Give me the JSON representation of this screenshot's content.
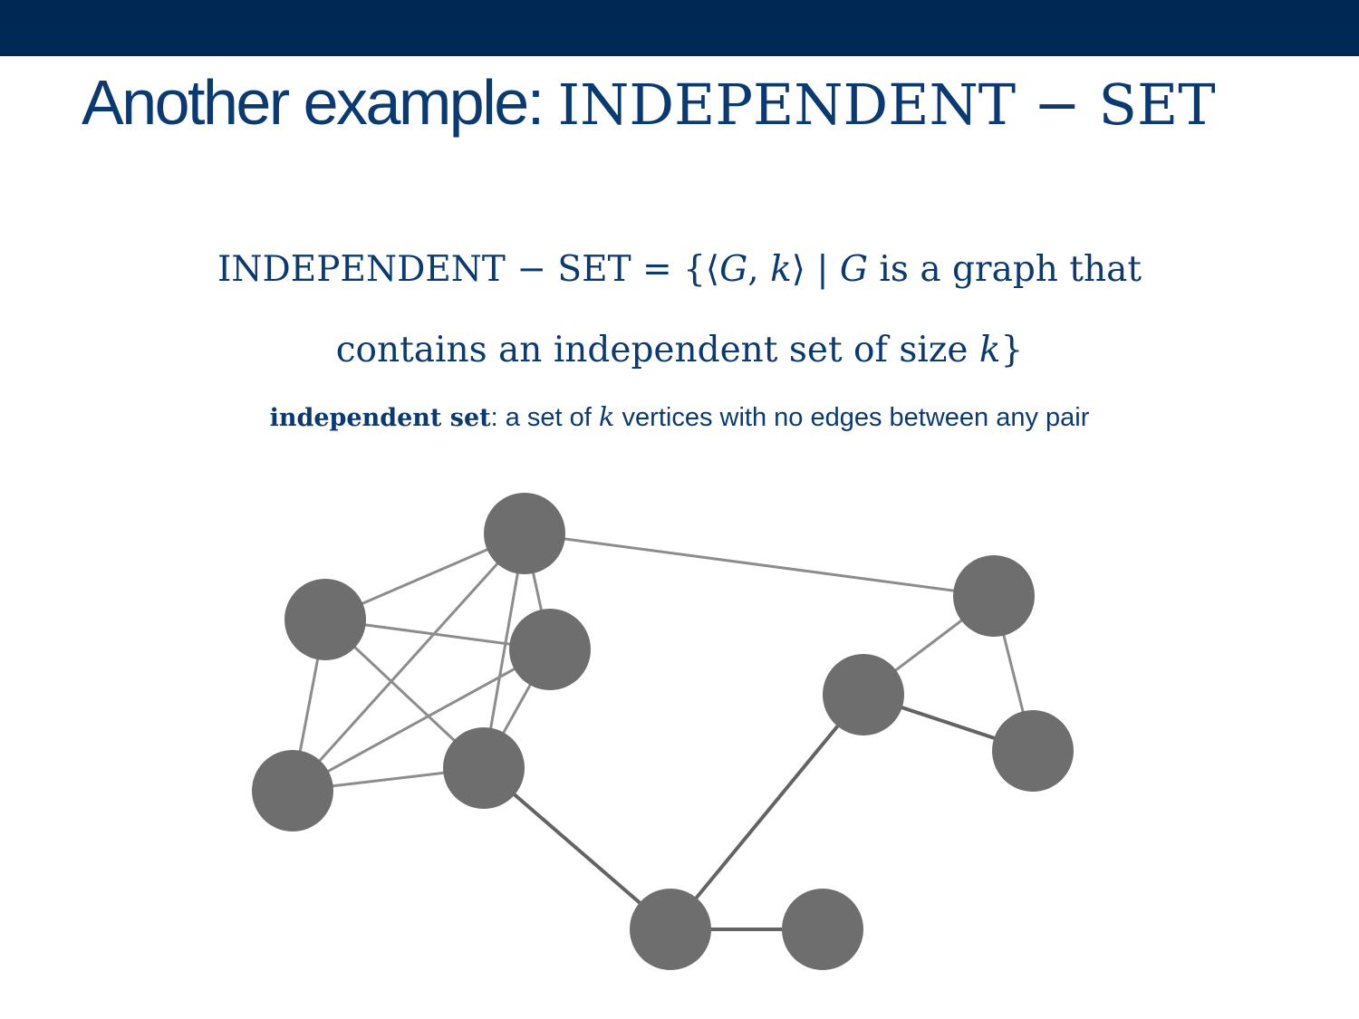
{
  "header": {
    "title_prefix": "Another example: ",
    "title_problem": "INDEPENDENT − SET"
  },
  "definition": {
    "line1_head": "INDEPENDENT − SET = {⟨",
    "line1_G": "G",
    "line1_comma": ", ",
    "line1_k": "k",
    "line1_mid": "⟩ | ",
    "line1_G2": "G",
    "line1_tail": " is a graph that",
    "line2_text": "contains an independent set of size ",
    "line2_k": "k",
    "line2_close": "}"
  },
  "note": {
    "term": "independent set",
    "before_k": ": a set of ",
    "k": "k",
    "after_k": " vertices with no edges between any pair"
  },
  "graph": {
    "vertex_color": "#6e6e6e",
    "edge_color": "#8c8c8c",
    "edge_dark_color": "#636363"
  }
}
